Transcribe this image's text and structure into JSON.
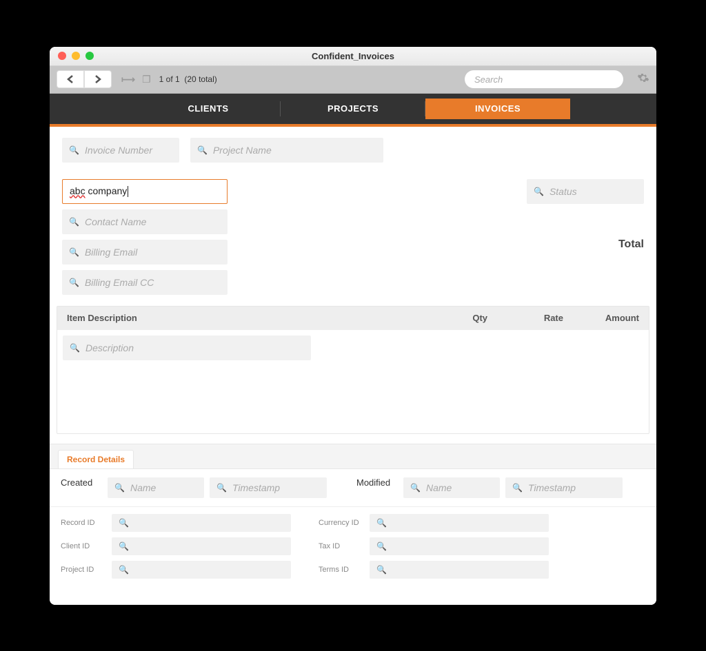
{
  "window": {
    "title": "Confident_Invoices"
  },
  "toolbar": {
    "record_position": "1",
    "record_of": "of",
    "record_count": "1",
    "record_total_label": "(20 total)",
    "search_placeholder": "Search"
  },
  "navtabs": {
    "clients": "CLIENTS",
    "projects": "PROJECTS",
    "invoices": "INVOICES"
  },
  "fields": {
    "invoice_number_ph": "Invoice Number",
    "project_name_ph": "Project Name",
    "company_value": "abc company",
    "contact_name_ph": "Contact Name",
    "billing_email_ph": "Billing Email",
    "billing_email_cc_ph": "Billing Email CC",
    "status_ph": "Status",
    "total_label": "Total"
  },
  "line_items": {
    "col_desc": "Item Description",
    "col_qty": "Qty",
    "col_rate": "Rate",
    "col_amount": "Amount",
    "description_ph": "Description"
  },
  "record_details": {
    "tab_label": "Record Details",
    "created_label": "Created",
    "modified_label": "Modified",
    "name_ph": "Name",
    "timestamp_ph": "Timestamp",
    "ids": {
      "record_id": "Record ID",
      "client_id": "Client ID",
      "project_id": "Project ID",
      "currency_id": "Currency ID",
      "tax_id": "Tax ID",
      "terms_id": "Terms ID"
    }
  }
}
